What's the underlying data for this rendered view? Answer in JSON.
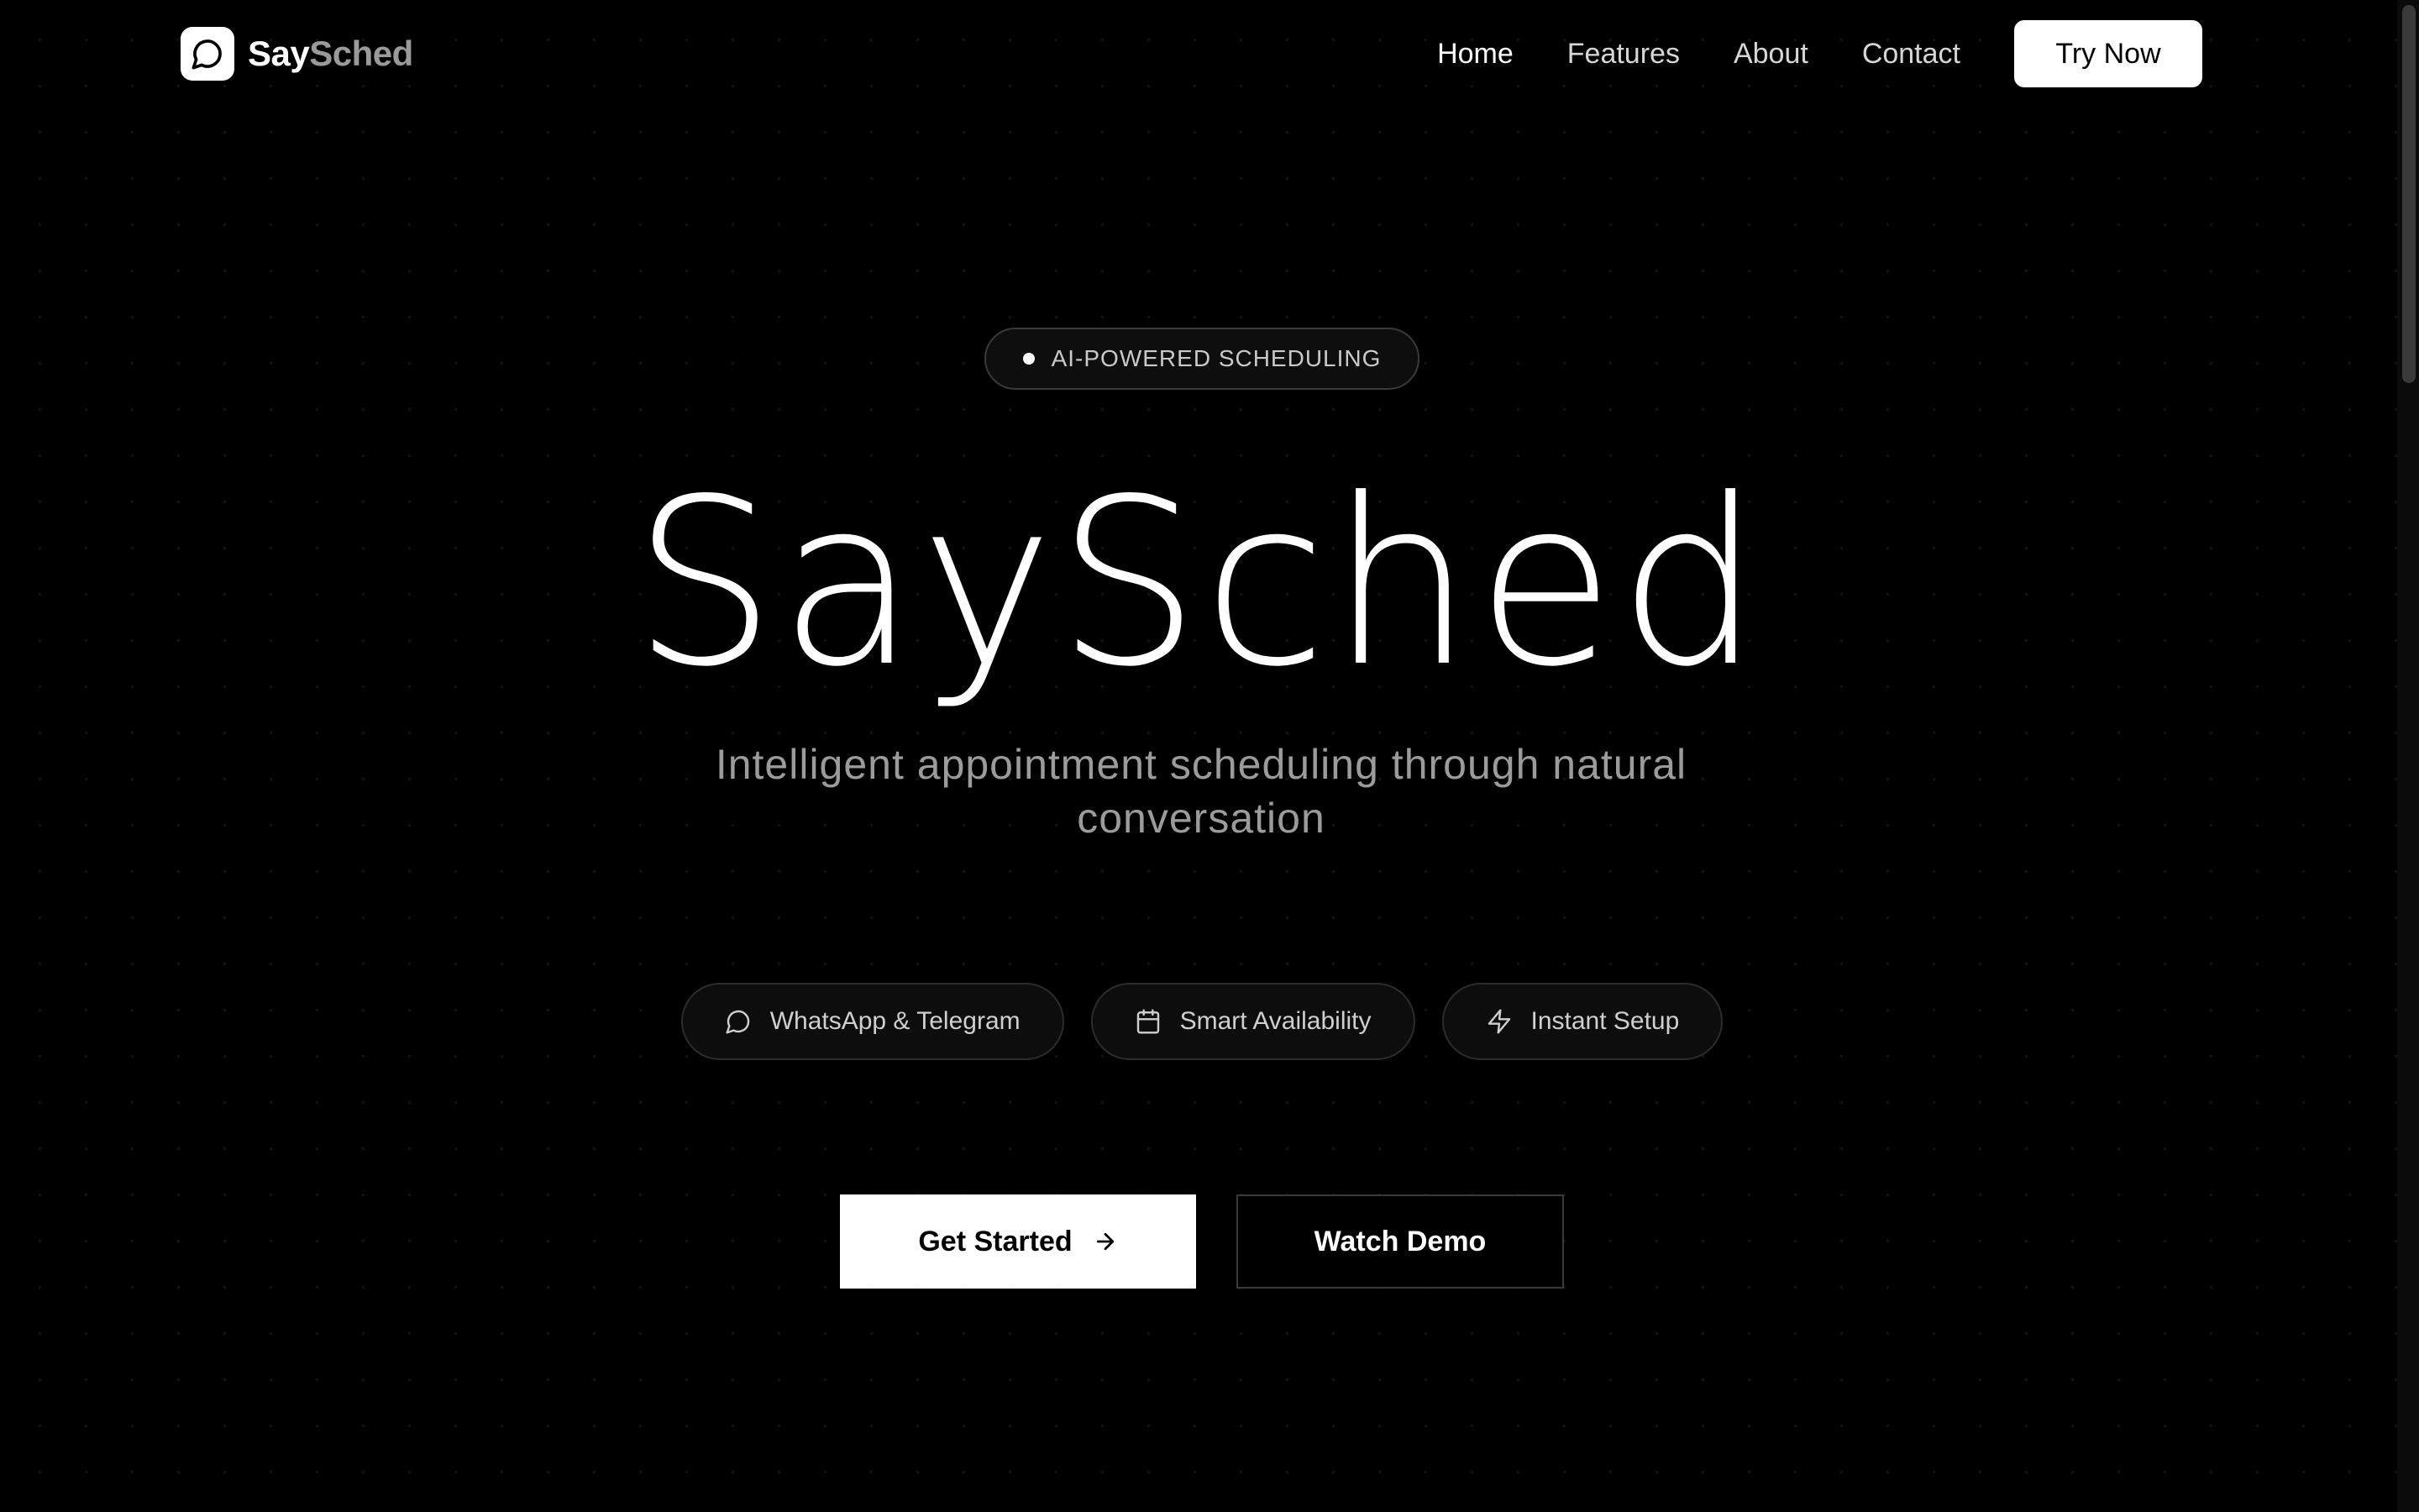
{
  "nav": {
    "brand_part1": "Say",
    "brand_part2": "Sched",
    "links": [
      "Home",
      "Features",
      "About",
      "Contact"
    ],
    "active_link": "Home",
    "cta_label": "Try Now"
  },
  "hero": {
    "badge": "AI-POWERED SCHEDULING",
    "title": "SaySched",
    "subtitle": "Intelligent appointment scheduling through natural conversation",
    "features": [
      {
        "icon": "message-circle-icon",
        "label": "WhatsApp & Telegram"
      },
      {
        "icon": "calendar-icon",
        "label": "Smart Availability"
      },
      {
        "icon": "lightning-icon",
        "label": "Instant Setup"
      }
    ],
    "primary_cta": "Get Started",
    "secondary_cta": "Watch Demo"
  },
  "colors": {
    "background": "#000000",
    "text": "#ffffff",
    "muted": "#9b9b9b",
    "border": "#3a3a3a"
  }
}
